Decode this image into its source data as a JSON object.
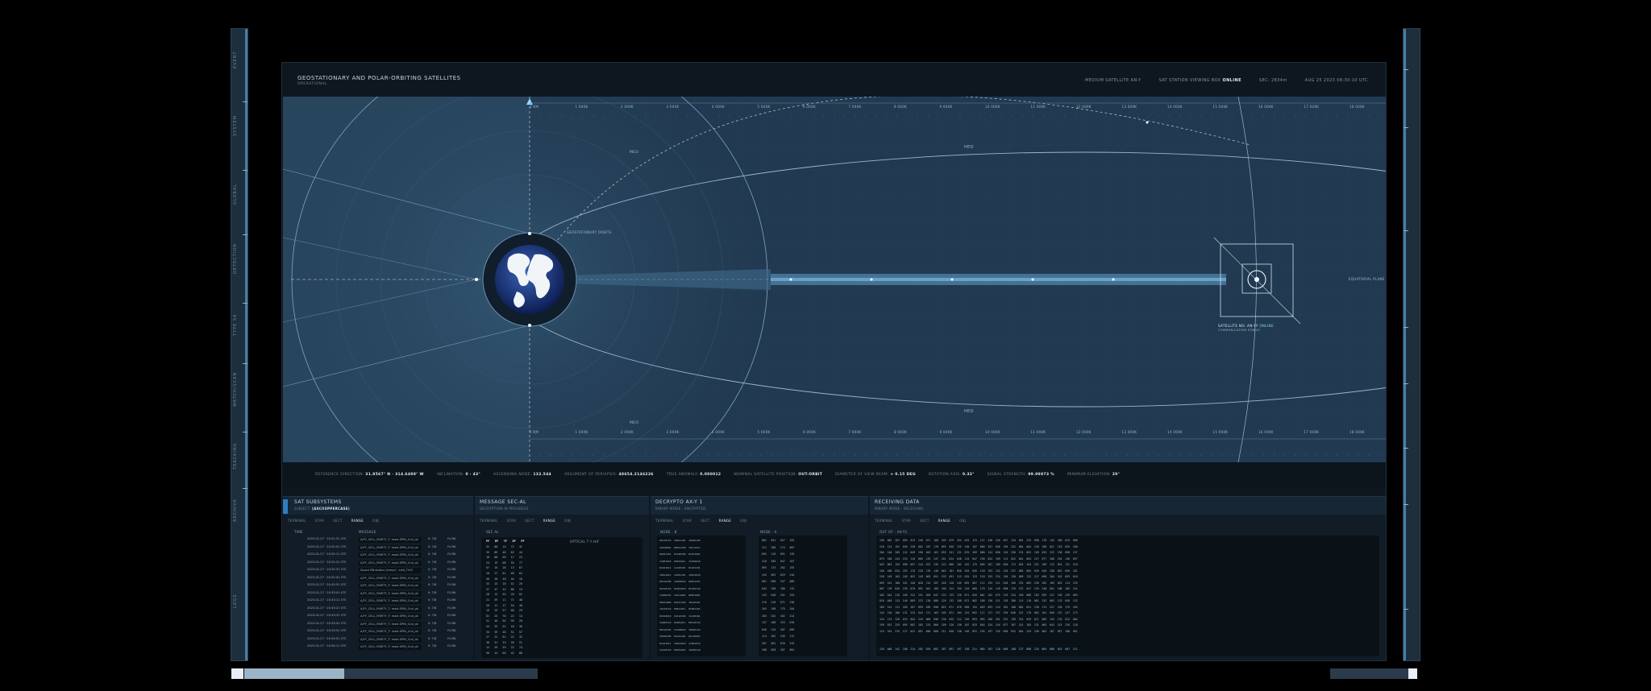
{
  "rail_left": {
    "labels": [
      "EVENT",
      "SYSTEM",
      "GLOBAL",
      "DETECTION",
      "TYPE S4",
      "WATCH/SCAN",
      "TRACKING",
      "ARCHIVE",
      "LOGS"
    ]
  },
  "header": {
    "title": "GEOSTATIONARY AND POLAR-ORBITING SATELLITES",
    "subtitle": "OPERATIONAL",
    "status": [
      {
        "label": "MEDIUM SATELLITE AN-Y",
        "value": ""
      },
      {
        "label": "SAT STATION VIEWING BOX",
        "value": "ONLINE"
      },
      {
        "label": "SEC: 2834m",
        "value": ""
      },
      {
        "label": "AUG 25 2023 08:30:10 UTC",
        "value": ""
      }
    ]
  },
  "map": {
    "labels": {
      "heo_top": "HEO",
      "heo_bottom": "HEO",
      "meo_top": "MEO",
      "meo_bottom": "MEO",
      "equatorial": "EQUATORIAL PLANE",
      "satellite_tag": "SATELLITE NO. AN-YY",
      "satellite_status": "ONLINE",
      "satellite_sub": "COMMUNICATION STABLE",
      "geo_label": "GEOSTATIONARY ORBITS"
    },
    "ruler_ticks": [
      "0 KM",
      "1 000K",
      "2 000K",
      "3 000K",
      "4 000K",
      "5 000K",
      "6 000K",
      "7 000K",
      "8 000K",
      "9 000K",
      "10 000K",
      "11 000K",
      "12 000K",
      "13 000K",
      "14 000K",
      "15 000K",
      "16 000K",
      "17 000K",
      "18 000K"
    ]
  },
  "params": [
    {
      "label": "REFERENCE DIRECTION:",
      "value": "31.8567° N · 314.6498° W"
    },
    {
      "label": "INCLINATION:",
      "value": "0 · 43°"
    },
    {
      "label": "ASCENDING NODE:",
      "value": "132.544"
    },
    {
      "label": "ARGUMENT OF PERIAPSIS:",
      "value": "48654.2146236"
    },
    {
      "label": "TRUE ANOMALY:",
      "value": "0.000012"
    },
    {
      "label": "NOMINAL SATELLITE POSITION:",
      "value": "OUT-ORBIT"
    },
    {
      "label": "DIAMETER OF VIEW BEAM:",
      "value": "≈ 0.15 DEG"
    },
    {
      "label": "ROTATION AXIS:",
      "value": "0.32°"
    },
    {
      "label": "SIGNAL STRENGTH:",
      "value": "99.99873 %"
    },
    {
      "label": "MINIMUM ELEVATION:",
      "value": "29°"
    }
  ],
  "panels": {
    "subsystems": {
      "title": "SAT SUBSYSTEMS",
      "subtitle_label": "SUBJECT:",
      "subtitle_value": "(ASCIIUPPERCASE)",
      "tabs": [
        "TERMINAL",
        "STAR",
        "SECT",
        "RANGE",
        "OBJ"
      ],
      "active_tab": "RANGE",
      "col_time": "TIME",
      "col_message": "MESSAGE",
      "rows": [
        {
          "ts": "2023-01-27 · 20:31:51 UTC",
          "msg": "A/FY_CELL_PARITY_T: mast.SPIN_Cnd_ok",
          "st": "0: 7/8",
          "fl": "FLOW"
        },
        {
          "ts": "2023-01-27 · 20:32:01 UTC",
          "msg": "A/FY_CELL_PARITY_T: mast.SPIN_Cnd_ok",
          "st": "0: 7/8",
          "fl": "FLOW"
        },
        {
          "ts": "2023-01-27 · 20:32:11 UTC",
          "msg": "A/FY_CELL_PARITY_T: mast.SPIN_Cnd_ok",
          "st": "0: 7/8",
          "fl": "FLOW"
        },
        {
          "ts": "2023-01-27 · 20:32:21 UTC",
          "msg": "A/FY_CELL_PARITY_T: mast.SPIN_Cnd_ok",
          "st": "0: 7/8",
          "fl": "FLOW"
        },
        {
          "ts": "2023-01-27 · 20:32:31 UTC",
          "msg": "Space RB-station (temp) · cold_T4.8",
          "st": "0: 7/8",
          "fl": "FLOW"
        },
        {
          "ts": "2023-01-27 · 20:32:41 UTC",
          "msg": "A/FY_CELL_PARITY_T: mast.SPIN_Cnd_ok",
          "st": "0: 7/8",
          "fl": "FLOW"
        },
        {
          "ts": "2023-01-27 · 20:32:51 UTC",
          "msg": "A/FY_CELL_PARITY_T: mast.SPIN_Cnd_ok",
          "st": "0: 7/8",
          "fl": "FLOW"
        },
        {
          "ts": "2023-01-27 · 20:33:01 UTC",
          "msg": "A/FY_CELL_PARITY_T: mast.SPIN_Cnd_ok",
          "st": "0: 7/8",
          "fl": "FLOW"
        },
        {
          "ts": "2023-01-27 · 20:33:11 UTC",
          "msg": "A/FY_CELL_PARITY_T: mast.SPIN_Cnd_ok",
          "st": "0: 7/8",
          "fl": "FLOW"
        },
        {
          "ts": "2023-01-27 · 20:33:21 UTC",
          "msg": "A/FY_CELL_PARITY_T: mast.SPIN_Cnd_ok",
          "st": "0: 7/8",
          "fl": "FLOW"
        },
        {
          "ts": "2023-01-27 · 20:33:31 UTC",
          "msg": "A/FY_CELL_PARITY_T: mast.SPIN_Cnd_ok",
          "st": "0: 7/8",
          "fl": "FLOW"
        },
        {
          "ts": "2023-01-27 · 20:33:41 UTC",
          "msg": "A/FY_CELL_PARITY_T: mast.SPIN_Cnd_ok",
          "st": "0: 7/8",
          "fl": "FLOW"
        },
        {
          "ts": "2023-01-27 · 20:33:51 UTC",
          "msg": "A/FY_CELL_PARITY_T: mast.SPIN_Cnd_ok",
          "st": "0: 7/8",
          "fl": "FLOW"
        },
        {
          "ts": "2023-01-27 · 20:34:01 UTC",
          "msg": "A/FY_CELL_PARITY_T: mast.SPIN_Cnd_ok",
          "st": "0: 7/8",
          "fl": "FLOW"
        },
        {
          "ts": "2023-01-27 · 20:34:11 UTC",
          "msg": "A/FY_CELL_PARITY_T: mast.SPIN_Cnd_ok",
          "st": "0: 7/8",
          "fl": "FLOW"
        }
      ]
    },
    "message": {
      "title": "MESSAGE SEC-AL",
      "subtitle": "DECRYPTION IN PROGRESS",
      "tabs": [
        "TERMINAL",
        "STAR",
        "SECT",
        "RANGE",
        "OBJ"
      ],
      "active_tab": "RANGE",
      "col_head": "SEC AL",
      "header_cells": "FF   EF   7F   EF   FF",
      "optical_label": "OPTICAL T·Y·HIF",
      "grid": "32   08   1A   72   4C\n35   89   48   62   44\n18   08   09   17   23\n24   19   08   92   77\n07   16   28   13   67\n18   27   81   09   64\n46   18   40   44   10\n53   15   18   51   26\n37   47   42   86   13\n28   12   55   26   01\n21   39   11   71   48\n26   11   27   54   40\n19   19   57   68   29\n81   25   70   22   14\n51   48   04   99   20\n44   33   01   18   36\n34   39   48   51   57\n27   22   81   22   32\n38   51   33   26   51\n12   29   59   22   74\n36   14   66   42   88"
    },
    "decrypto": {
      "title": "DECRYPTO AX-Y 1",
      "subtitle": "BINARY MODE · ENCRYPTED",
      "tabs": [
        "TERMINAL",
        "STAR",
        "SECT",
        "RANGE",
        "OBJ"
      ],
      "active_tab": "RANGE",
      "col_a": "NODE · B",
      "col_b": "NODE · A",
      "grid_a": "00110110  10011101  10010100\n10010001  00011100  10111011\n00101101  01100100  01011001\n11001010  00101011  11010010\n01101011  11100101  01101101\n10011011  11001101  10101010\n00110100  10100010  00011101\n01010110  01001010  01100110\n11000101  10111001  00011001\n00101000  01011100  10110101\n10110110  00011011  01001101\n01010010  10110100  11100101\n11000110  01001011  00110110\n00110101  11100010  10010110\n10010100  01101101  01110001\n01101011  10011010  11001010\n11010110  00101001  10100110",
      "grid_b": "002   831   027   263\n112   208   274   087\n092   116   051   195\n118   205   047   167\n095   175   202   193\n126   092   029   216\n061   038   257   089\n044   198   180   132\n133   018   251   254\n170   216   071   238\n165   198   175   104\n183   252   162   214\n137   108   253   076\n046   215   207   099\n114   202   249   112\n207   051   076   233\n188   028   207   081"
    },
    "receiving": {
      "title": "RECEIVING DATA",
      "subtitle": "BINARY MODE · RECEIVING",
      "tabs": [
        "TERMINAL",
        "STAR",
        "SECT",
        "RANGE",
        "OBJ"
      ],
      "active_tab": "RANGE",
      "col_head": "OUT OF · AX-Y1",
      "grid": "130  082  207  055  013  246  071  168  103  079  254  019  125  111  248  220  057  134  061  233  090  178  142  206  015  086\n218  124  191  026  238  082  187  170  093  056  135  240  107  066  247  036  199  232  081  064  126  188  021  153  029  180\n204  140  205  141  049  196  043  161  033  241  121  070  209  080  124  096  145  250  132  092  183  025  222  138  098  137\n079  168  244  153  116  085  129  247  181  014  048  114  047  190  024  169  113  052  041  063  227  077  206  181  148  097\n043  063  155  098  097  244  072  235  142  086  162  101  175  056  207  189  030  173  045  164  251  209  113  051  122  218\n156  180  034  253  176  228  176  146  045  181  050  204  045  118  193  152  218  237  083  084  049  016  238  052  036  181\n220  149  103  165  092  149  063  051  193  091  113  034  133  218  153  234  150  130  069  132  217  090  204  161  093  018\n059  241  180  161  146  028  114  207  248  120  245  092  067  111  155  211  018  166  232  085  236  202  109  033  114  235\n087  176  045  236  076  091  041  166  168  124  195  210  060  170  134  145  098  176  197  047  134  248  051  108  185  141\n182  024  216  246  241  151  029  047  133  133  120  071  026  081  102  075  219  234  250  088  103  039  247  156  239  083\n016  048  113  146  089  223  118  086  126  132  168  072  082  188  136  211  126  206  113  110  061  252  063  123  030  132\n189  241  111  203  167  099  209  050  025  071  076  090  155  049  093  124  162  188  081  041  238  174  227  150  179  203\n154  210  180  131  223  043  171  163  105  071  104  151  092  117  127  237  195  046  222  170  062  101  040  157  247  173\n124  174  228  074  054  116  060  056  136  035  112  236  093  095  100  201  251  136  214  039  071  083  154  176  012  084\n199  022  229  095  082  183  224  066  109  120  136  207  033  054  234  244  077  187  241  184  131  065  043  151  226  120\n115  101  215  127  041  091  040  068  211  046  138  146  051  194  197  235  050  032  044  243  150  062  167  057  188  051",
      "footer": "134  048  141  188  114  182  070  001  207  091  197  158  211  085  107  118  050  108  127  088  125  064  060  015  007  111"
    }
  },
  "colors": {
    "map_bg": "#28455e",
    "accent": "#2e7ec0",
    "highlight": "#7fd0ff"
  }
}
